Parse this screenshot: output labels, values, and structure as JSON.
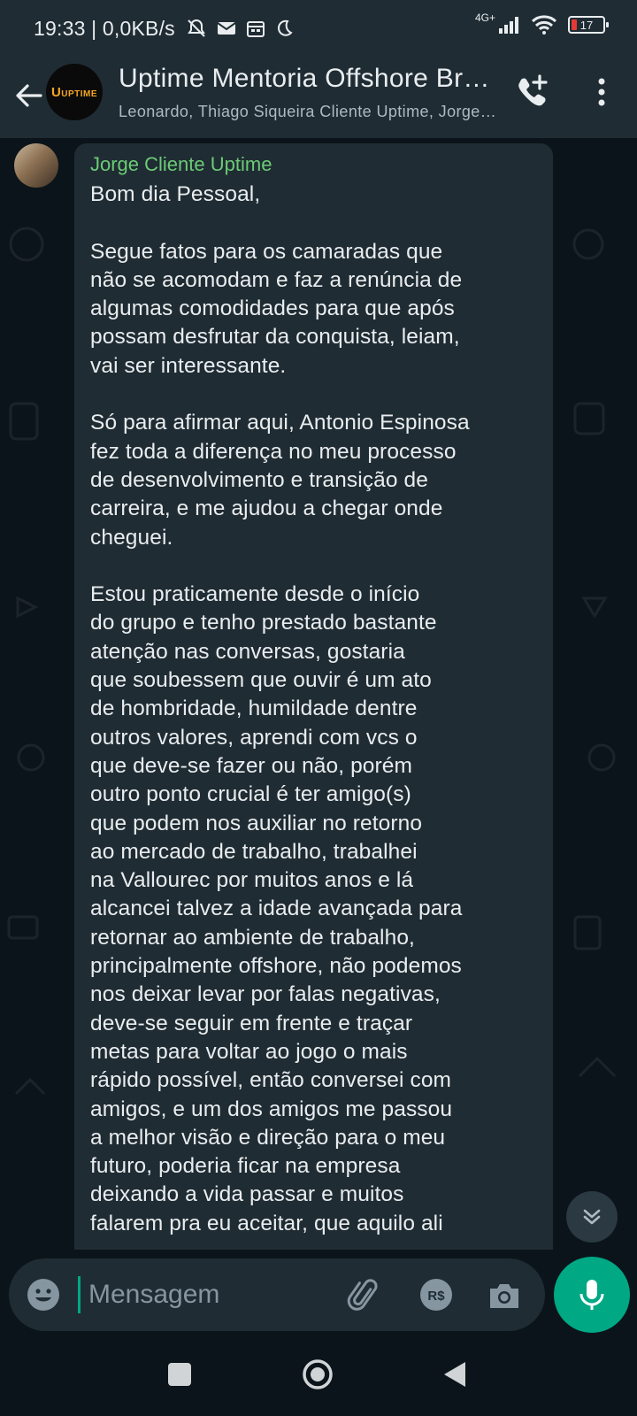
{
  "status_bar": {
    "time_speed": "19:33 | 0,0KB/s",
    "network": "4G+",
    "battery": "17",
    "battery_color": "#e53935",
    "icons": [
      "mute-bell-icon",
      "mail-icon",
      "calendar-icon",
      "moon-icon",
      "signal-icon",
      "wifi-icon",
      "battery-icon"
    ]
  },
  "header": {
    "title": "Uptime Mentoria Offshore Brasil",
    "subtitle": "Leonardo, Thiago Siqueira Cliente Uptime, Jorge Cliente Uptime",
    "logo_text": "UPTIME",
    "icons": [
      "back-arrow-icon",
      "add-call-icon",
      "more-vert-icon"
    ]
  },
  "message": {
    "sender": "Jorge Cliente Uptime",
    "sender_color": "#6bcb77",
    "text": "Bom dia Pessoal,\n\nSegue fatos para os camaradas que\nnão se acomodam e faz a renúncia de\nalgumas comodidades para que após\npossam desfrutar da conquista, leiam,\nvai ser interessante.\n\nSó para afirmar aqui, Antonio Espinosa\nfez toda a diferença no meu processo\nde desenvolvimento e transição de\ncarreira, e me ajudou a chegar onde\ncheguei.\n\nEstou praticamente desde o início\ndo grupo e tenho prestado bastante\natenção nas conversas, gostaria\nque soubessem que ouvir é um ato\nde hombridade, humildade dentre\noutros valores, aprendi com vcs o\nque deve-se fazer ou não, porém\noutro ponto crucial é ter amigo(s)\nque podem nos auxiliar no retorno\nao mercado de trabalho, trabalhei\nna Vallourec por muitos anos e lá\nalcancei talvez a idade avançada para\nretornar ao ambiente de trabalho,\nprincipalmente offshore, não podemos\nnos deixar levar por falas negativas,\ndeve-se seguir em frente e traçar\nmetas para voltar ao jogo o mais\nrápido possível, então conversei com\namigos, e um dos amigos me passou\na melhor visão e direção para o meu\nfuturo, poderia ficar na empresa\ndeixando a vida passar e muitos\nfalarem pra eu aceitar, que aquilo ali"
  },
  "composer": {
    "placeholder": "Mensagem",
    "icons": [
      "emoji-icon",
      "attach-icon",
      "payment-icon",
      "camera-icon",
      "mic-icon",
      "scroll-down-icon"
    ],
    "accent": "#00a884"
  },
  "nav_bar": {
    "icons": [
      "recents-icon",
      "home-icon",
      "back-icon"
    ]
  }
}
